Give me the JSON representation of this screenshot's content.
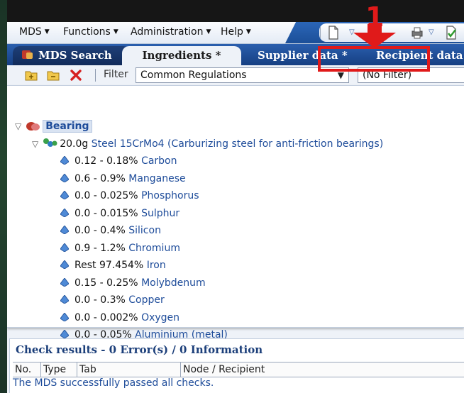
{
  "menu": {
    "items": [
      {
        "label": "MDS"
      },
      {
        "label": "Functions"
      },
      {
        "label": "Administration"
      },
      {
        "label": "Help"
      }
    ]
  },
  "tabs": [
    {
      "label": "MDS Search"
    },
    {
      "label": "Ingredients *"
    },
    {
      "label": "Supplier data *"
    },
    {
      "label": "Recipient data *"
    }
  ],
  "filter": {
    "label": "Filter",
    "selected": "Common Regulations",
    "second_selected": "(No Filter)"
  },
  "tree": {
    "root": {
      "label": "Bearing"
    },
    "material": {
      "weight": "20.0g",
      "name": "Steel 15CrMo4 (Carburizing steel for anti-friction bearings)"
    },
    "substances": [
      {
        "pct": "0.12 - 0.18%",
        "name": "Carbon"
      },
      {
        "pct": "0.6 - 0.9%",
        "name": "Manganese"
      },
      {
        "pct": "0.0 - 0.025%",
        "name": "Phosphorus"
      },
      {
        "pct": "0.0 - 0.015%",
        "name": "Sulphur"
      },
      {
        "pct": "0.0 - 0.4%",
        "name": "Silicon"
      },
      {
        "pct": "0.9 - 1.2%",
        "name": "Chromium"
      },
      {
        "pct": "Rest 97.454%",
        "name": "Iron"
      },
      {
        "pct": "0.15 - 0.25%",
        "name": "Molybdenum"
      },
      {
        "pct": "0.0 - 0.3%",
        "name": "Copper"
      },
      {
        "pct": "0.0 - 0.002%",
        "name": "Oxygen"
      },
      {
        "pct": "0.0 - 0.05%",
        "name": "Aluminium (metal)"
      }
    ]
  },
  "results": {
    "title": "Check results - 0 Error(s) / 0 Information",
    "columns": [
      "No.",
      "Type",
      "Tab",
      "Node / Recipient"
    ],
    "message": "The MDS successfully passed all checks."
  },
  "annotation": {
    "number": "1"
  },
  "colors": {
    "annotation": "#e01a1a",
    "tab_bar": "#1e4c9a",
    "link_text": "#1e4c9a"
  }
}
